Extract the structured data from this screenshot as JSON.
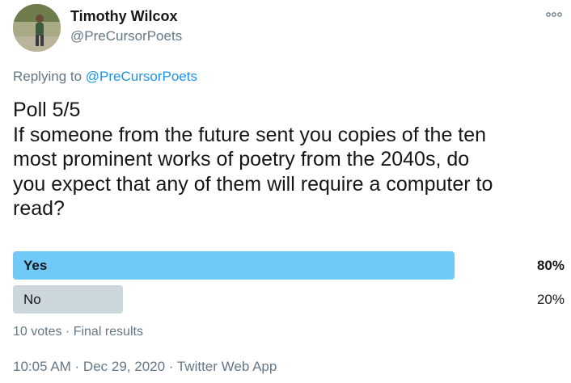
{
  "author": {
    "display_name": "Timothy Wilcox",
    "handle": "@PreCursorPoets"
  },
  "more_icon": "more-options-icon",
  "reply": {
    "prefix": "Replying to",
    "to_handle": "@PreCursorPoets"
  },
  "tweet": {
    "lines": [
      "Poll 5/5",
      "If someone from the future sent you copies of the ten",
      "most prominent works of poetry from the 2040s, do",
      "you expect that any of them will require a computer to",
      "read?"
    ]
  },
  "poll": {
    "options": [
      {
        "label": "Yes",
        "percent_text": "80%",
        "fraction": 0.8,
        "winner": true
      },
      {
        "label": "No",
        "percent_text": "20%",
        "fraction": 0.2,
        "winner": false
      }
    ],
    "meta": "10 votes · Final results"
  },
  "footer": {
    "timestamp": "10:05 AM · Dec 29, 2020 · Twitter Web App"
  },
  "colors": {
    "winner_bar": "#71c9f8",
    "loser_bar": "#ccd6dd",
    "link": "#1b95e0",
    "secondary_text": "#657786"
  }
}
